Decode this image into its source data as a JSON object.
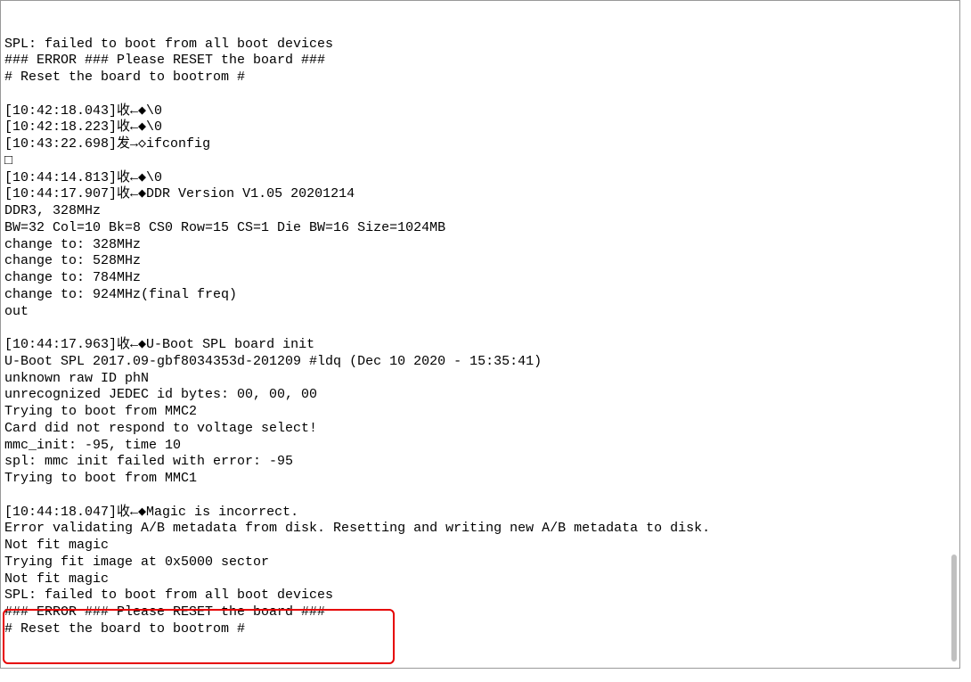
{
  "terminal": {
    "lines": [
      "SPL: failed to boot from all boot devices",
      "### ERROR ### Please RESET the board ###",
      "# Reset the board to bootrom #",
      "",
      "[10:42:18.043]收←◆\\0",
      "[10:42:18.223]收←◆\\0",
      "[10:43:22.698]发→◇ifconfig",
      "□",
      "[10:44:14.813]收←◆\\0",
      "[10:44:17.907]收←◆DDR Version V1.05 20201214",
      "DDR3, 328MHz",
      "BW=32 Col=10 Bk=8 CS0 Row=15 CS=1 Die BW=16 Size=1024MB",
      "change to: 328MHz",
      "change to: 528MHz",
      "change to: 784MHz",
      "change to: 924MHz(final freq)",
      "out",
      "",
      "[10:44:17.963]收←◆U-Boot SPL board init",
      "U-Boot SPL 2017.09-gbf8034353d-201209 #ldq (Dec 10 2020 - 15:35:41)",
      "unknown raw ID phN",
      "unrecognized JEDEC id bytes: 00, 00, 00",
      "Trying to boot from MMC2",
      "Card did not respond to voltage select!",
      "mmc_init: -95, time 10",
      "spl: mmc init failed with error: -95",
      "Trying to boot from MMC1",
      "",
      "[10:44:18.047]收←◆Magic is incorrect.",
      "Error validating A/B metadata from disk. Resetting and writing new A/B metadata to disk.",
      "Not fit magic",
      "Trying fit image at 0x5000 sector",
      "Not fit magic",
      "SPL: failed to boot from all boot devices",
      "### ERROR ### Please RESET the board ###",
      "# Reset the board to bootrom #"
    ]
  },
  "highlight": {
    "target_lines_start": 33,
    "target_lines_end": 35
  }
}
